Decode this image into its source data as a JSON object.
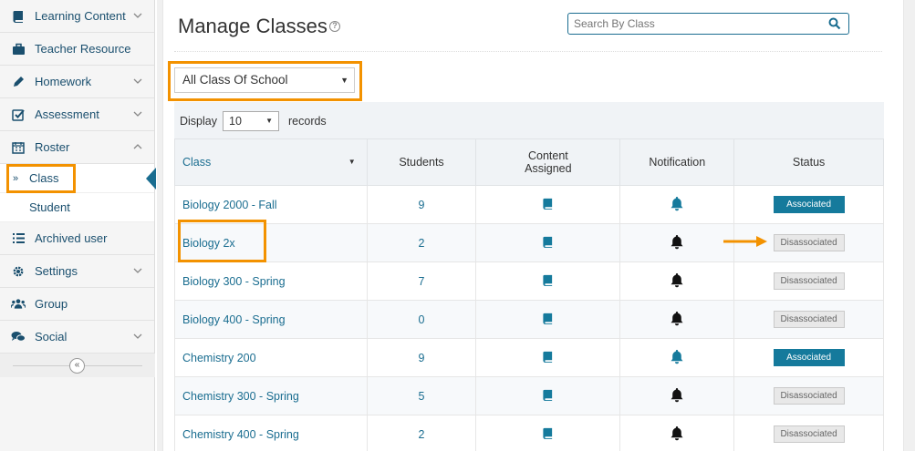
{
  "sidebar": {
    "items": [
      {
        "label": "Learning Content",
        "icon": "book-icon",
        "chevron": "down"
      },
      {
        "label": "Teacher Resource",
        "icon": "briefcase-icon",
        "chevron": ""
      },
      {
        "label": "Homework",
        "icon": "pencil-icon",
        "chevron": "down"
      },
      {
        "label": "Assessment",
        "icon": "check-square-icon",
        "chevron": "down"
      },
      {
        "label": "Roster",
        "icon": "calendar-icon",
        "chevron": "up"
      }
    ],
    "roster_sub": [
      {
        "label": "Class",
        "marker": "»"
      },
      {
        "label": "Student"
      }
    ],
    "items_after": [
      {
        "label": "Archived user",
        "icon": "list-icon",
        "chevron": ""
      },
      {
        "label": "Settings",
        "icon": "gear-icon",
        "chevron": "down"
      },
      {
        "label": "Group",
        "icon": "users-icon",
        "chevron": ""
      },
      {
        "label": "Social",
        "icon": "comments-icon",
        "chevron": "down"
      }
    ],
    "collapse_glyph": "«"
  },
  "header": {
    "title": "Manage Classes",
    "help_glyph": "?",
    "search_placeholder": "Search By Class"
  },
  "filter": {
    "selected": "All Class Of School"
  },
  "table": {
    "display_label": "Display",
    "records_value": "10",
    "records_label": "records",
    "columns": [
      "Class",
      "Students",
      "Content Assigned",
      "Notification",
      "Status"
    ],
    "rows": [
      {
        "class": "Biology 2000 - Fall",
        "students": "9",
        "status": "Associated"
      },
      {
        "class": "Biology 2x",
        "students": "2",
        "status": "Disassociated"
      },
      {
        "class": "Biology 300 - Spring",
        "students": "7",
        "status": "Disassociated"
      },
      {
        "class": "Biology 400 - Spring",
        "students": "0",
        "status": "Disassociated"
      },
      {
        "class": "Chemistry 200",
        "students": "9",
        "status": "Associated"
      },
      {
        "class": "Chemistry 300 - Spring",
        "students": "5",
        "status": "Disassociated"
      },
      {
        "class": "Chemistry 400 - Spring",
        "students": "2",
        "status": "Disassociated"
      }
    ]
  },
  "colors": {
    "accent": "#1a6d90",
    "associated": "#157a9c",
    "highlight": "#f39200"
  }
}
